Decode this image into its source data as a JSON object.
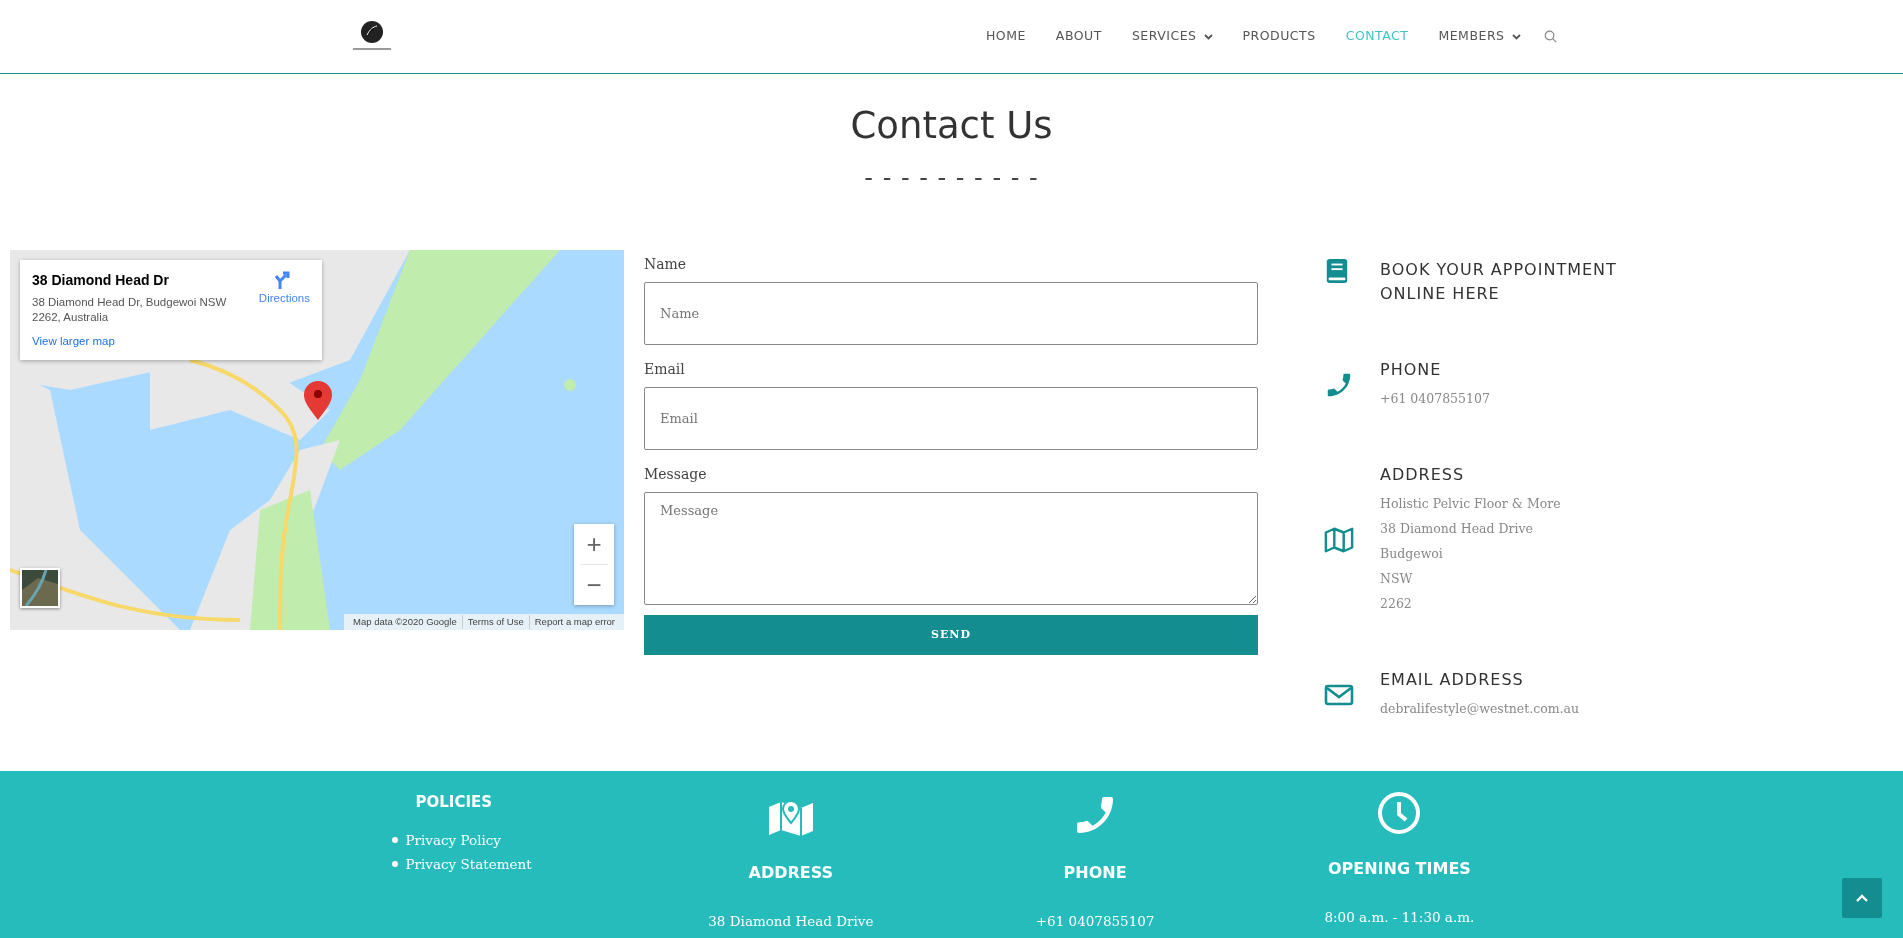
{
  "nav": {
    "items": [
      {
        "label": "HOME",
        "selected": false,
        "has_menu": false
      },
      {
        "label": "ABOUT",
        "selected": false,
        "has_menu": false
      },
      {
        "label": "SERVICES",
        "selected": false,
        "has_menu": true
      },
      {
        "label": "PRODUCTS",
        "selected": false,
        "has_menu": false
      },
      {
        "label": "CONTACT",
        "selected": true,
        "has_menu": false
      },
      {
        "label": "MEMBERS",
        "selected": false,
        "has_menu": true
      }
    ]
  },
  "page_title": "Contact Us",
  "title_divider": "- - - - - - - - - -",
  "map": {
    "place_title": "38 Diamond Head Dr",
    "place_address": "38 Diamond Head Dr, Budgewoi NSW 2262, Australia",
    "directions": "Directions",
    "larger_map_link": "View larger map",
    "zoom_in": "+",
    "zoom_out": "−",
    "attribution": [
      "Map data ©2020 Google",
      "Terms of Use",
      "Report a map error"
    ]
  },
  "form": {
    "fields": [
      {
        "kind": "input",
        "label": "Name",
        "placeholder": "Name"
      },
      {
        "kind": "input",
        "label": "Email",
        "placeholder": "Email"
      },
      {
        "kind": "textarea",
        "label": "Message",
        "placeholder": "Message"
      }
    ],
    "submit": "SEND"
  },
  "contact_items": [
    {
      "kind": "book",
      "title": "BOOK YOUR APPOINTMENT ONLINE HERE"
    },
    {
      "kind": "phone",
      "title": "PHONE",
      "lines": [
        "+61 0407855107"
      ]
    },
    {
      "kind": "map",
      "title": "ADDRESS",
      "lines": [
        "Holistic Pelvic Floor & More",
        "38 Diamond Head Drive",
        "Budgewoi",
        "NSW",
        "2262"
      ]
    },
    {
      "kind": "mail",
      "title": "EMAIL ADDRESS",
      "lines": [
        "debralifestyle@westnet.com.au"
      ]
    }
  ],
  "footer": {
    "policies": {
      "title": "POLICIES",
      "links": [
        "Privacy Policy",
        "Privacy Statement"
      ]
    },
    "columns": [
      {
        "kind": "map-pin",
        "title": "ADDRESS",
        "text": "38 Diamond Head Drive"
      },
      {
        "kind": "phone",
        "title": "PHONE",
        "text": "+61 0407855107"
      },
      {
        "kind": "clock",
        "title": "OPENING TIMES",
        "text": "8:00 a.m. - 11:30 a.m."
      }
    ]
  }
}
